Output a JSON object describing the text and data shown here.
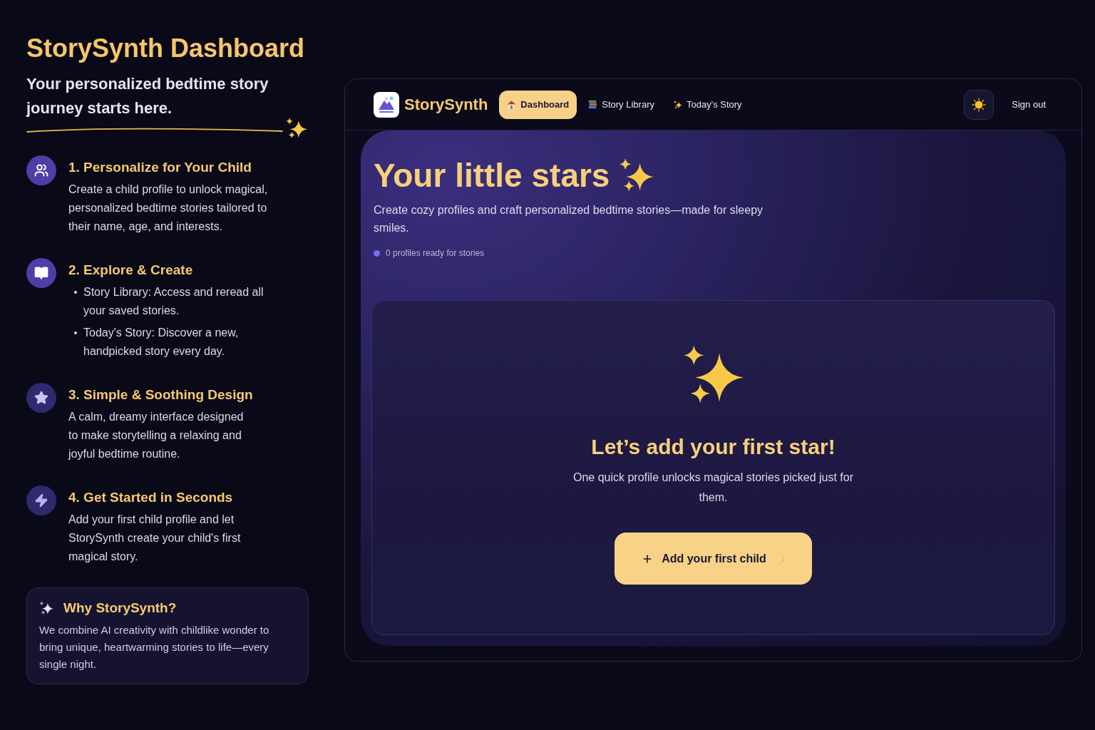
{
  "sidebar": {
    "title": "StorySynth Dashboard",
    "subtitle": "Your personalized bedtime story journey starts here.",
    "features": [
      {
        "kind": "paragraph",
        "title": "1. Personalize for Your Child",
        "text": "Create a child profile to unlock magical, personalized bedtime stories tailored to their name, age, and interests."
      },
      {
        "kind": "bullets",
        "title": "2. Explore & Create",
        "bullets": [
          "Story Library: Access and reread all your saved stories.",
          "Today's Story: Discover a new, handpicked story every day."
        ]
      },
      {
        "kind": "paragraph",
        "title": "3. Simple & Soothing Design",
        "text": "A calm, dreamy interface designed to make storytelling a relaxing and joyful bedtime routine."
      },
      {
        "kind": "paragraph",
        "title": "4. Get Started in Seconds",
        "text": "Add your first child profile and let StorySynth create your child's first magical story."
      }
    ],
    "info_card": {
      "title": "Why StorySynth?",
      "text": "We combine AI creativity with childlike wonder to bring unique, heartwarming stories to life—every single night."
    }
  },
  "app": {
    "brand": "StorySynth",
    "nav": [
      {
        "label": "Dashboard",
        "selected": true
      },
      {
        "label": "Story Library",
        "selected": false
      },
      {
        "label": "Today's Story",
        "selected": false
      }
    ],
    "sign_out": "Sign out",
    "hero": {
      "title": "Your little stars",
      "subtitle": "Create cozy profiles and craft personalized bedtime stories—made for sleepy smiles.",
      "status": "0 profiles ready for stories"
    },
    "empty_state": {
      "title": "Let’s add your first star!",
      "text": "One quick profile unlocks magical stories picked just for them.",
      "button": "Add your first child"
    }
  }
}
